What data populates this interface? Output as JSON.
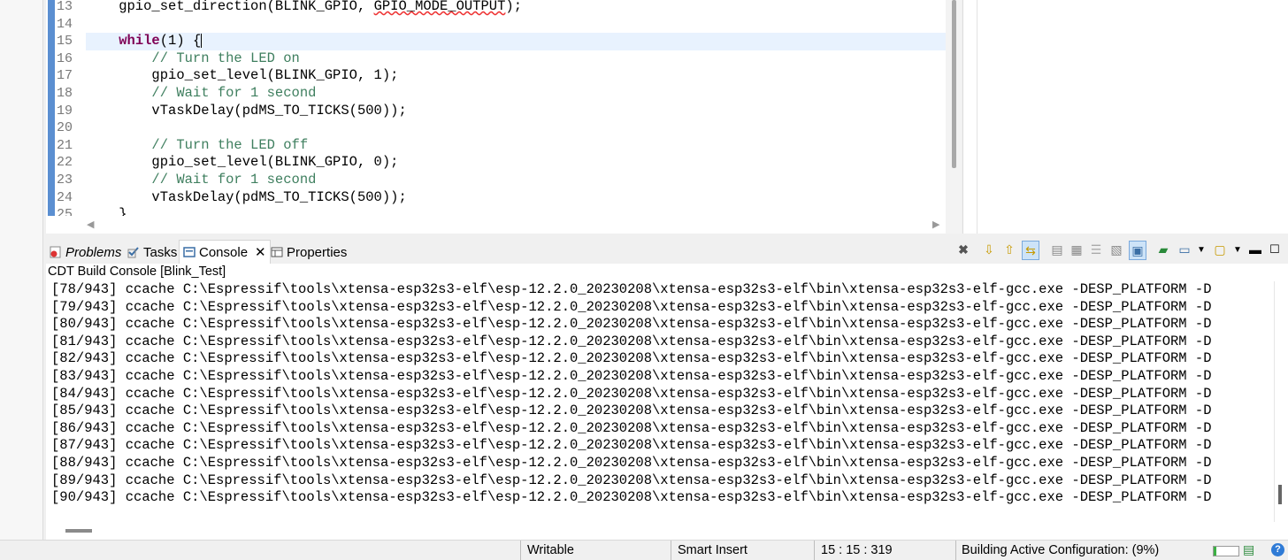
{
  "editor": {
    "lines": [
      {
        "num": "13",
        "parts": [
          {
            "t": "    gpio_set_direction(BLINK_GPIO, "
          },
          {
            "t": "GPIO_MODE_OUTPUT",
            "c": "squig"
          },
          {
            "t": ");"
          }
        ]
      },
      {
        "num": "14",
        "parts": []
      },
      {
        "num": "15",
        "current": true,
        "parts": [
          {
            "t": "    "
          },
          {
            "t": "while",
            "c": "kw"
          },
          {
            "t": "(1) {"
          }
        ]
      },
      {
        "num": "16",
        "parts": [
          {
            "t": "        // Turn the LED on",
            "c": "cm"
          }
        ]
      },
      {
        "num": "17",
        "parts": [
          {
            "t": "        gpio_set_level(BLINK_GPIO, 1);"
          }
        ]
      },
      {
        "num": "18",
        "parts": [
          {
            "t": "        // Wait for 1 second",
            "c": "cm"
          }
        ]
      },
      {
        "num": "19",
        "parts": [
          {
            "t": "        vTaskDelay(pdMS_TO_TICKS(500));"
          }
        ]
      },
      {
        "num": "20",
        "parts": []
      },
      {
        "num": "21",
        "parts": [
          {
            "t": "        // Turn the LED off",
            "c": "cm"
          }
        ]
      },
      {
        "num": "22",
        "parts": [
          {
            "t": "        gpio_set_level(BLINK_GPIO, 0);"
          }
        ]
      },
      {
        "num": "23",
        "parts": [
          {
            "t": "        // Wait for 1 second",
            "c": "cm"
          }
        ]
      },
      {
        "num": "24",
        "parts": [
          {
            "t": "        vTaskDelay(pdMS_TO_TICKS(500));"
          }
        ]
      },
      {
        "num": "25",
        "parts": [
          {
            "t": "    }"
          }
        ]
      }
    ]
  },
  "views": {
    "tabs": {
      "problems": "Problems",
      "tasks": "Tasks",
      "console": "Console",
      "properties": "Properties"
    },
    "console_title": "CDT Build Console [Blink_Test]",
    "console_lines": [
      "[78/943] ccache C:\\Espressif\\tools\\xtensa-esp32s3-elf\\esp-12.2.0_20230208\\xtensa-esp32s3-elf\\bin\\xtensa-esp32s3-elf-gcc.exe -DESP_PLATFORM -D",
      "[79/943] ccache C:\\Espressif\\tools\\xtensa-esp32s3-elf\\esp-12.2.0_20230208\\xtensa-esp32s3-elf\\bin\\xtensa-esp32s3-elf-gcc.exe -DESP_PLATFORM -D",
      "[80/943] ccache C:\\Espressif\\tools\\xtensa-esp32s3-elf\\esp-12.2.0_20230208\\xtensa-esp32s3-elf\\bin\\xtensa-esp32s3-elf-gcc.exe -DESP_PLATFORM -D",
      "[81/943] ccache C:\\Espressif\\tools\\xtensa-esp32s3-elf\\esp-12.2.0_20230208\\xtensa-esp32s3-elf\\bin\\xtensa-esp32s3-elf-gcc.exe -DESP_PLATFORM -D",
      "[82/943] ccache C:\\Espressif\\tools\\xtensa-esp32s3-elf\\esp-12.2.0_20230208\\xtensa-esp32s3-elf\\bin\\xtensa-esp32s3-elf-gcc.exe -DESP_PLATFORM -D",
      "[83/943] ccache C:\\Espressif\\tools\\xtensa-esp32s3-elf\\esp-12.2.0_20230208\\xtensa-esp32s3-elf\\bin\\xtensa-esp32s3-elf-gcc.exe -DESP_PLATFORM -D",
      "[84/943] ccache C:\\Espressif\\tools\\xtensa-esp32s3-elf\\esp-12.2.0_20230208\\xtensa-esp32s3-elf\\bin\\xtensa-esp32s3-elf-gcc.exe -DESP_PLATFORM -D",
      "[85/943] ccache C:\\Espressif\\tools\\xtensa-esp32s3-elf\\esp-12.2.0_20230208\\xtensa-esp32s3-elf\\bin\\xtensa-esp32s3-elf-gcc.exe -DESP_PLATFORM -D",
      "[86/943] ccache C:\\Espressif\\tools\\xtensa-esp32s3-elf\\esp-12.2.0_20230208\\xtensa-esp32s3-elf\\bin\\xtensa-esp32s3-elf-gcc.exe -DESP_PLATFORM -D",
      "[87/943] ccache C:\\Espressif\\tools\\xtensa-esp32s3-elf\\esp-12.2.0_20230208\\xtensa-esp32s3-elf\\bin\\xtensa-esp32s3-elf-gcc.exe -DESP_PLATFORM -D",
      "[88/943] ccache C:\\Espressif\\tools\\xtensa-esp32s3-elf\\esp-12.2.0_20230208\\xtensa-esp32s3-elf\\bin\\xtensa-esp32s3-elf-gcc.exe -DESP_PLATFORM -D",
      "[89/943] ccache C:\\Espressif\\tools\\xtensa-esp32s3-elf\\esp-12.2.0_20230208\\xtensa-esp32s3-elf\\bin\\xtensa-esp32s3-elf-gcc.exe -DESP_PLATFORM -D",
      "[90/943] ccache C:\\Espressif\\tools\\xtensa-esp32s3-elf\\esp-12.2.0_20230208\\xtensa-esp32s3-elf\\bin\\xtensa-esp32s3-elf-gcc.exe -DESP_PLATFORM -D"
    ],
    "toolbar_icons": [
      "terminate-icon",
      "next-annotation-icon",
      "previous-annotation-icon",
      "link-icon",
      "clear-console-icon",
      "scroll-lock-icon",
      "word-wrap-icon",
      "show-on-output-icon",
      "pin-console-icon",
      "open-console-icon",
      "display-selected-console-icon",
      "new-console-view-icon",
      "view-menu-icon",
      "minimize-icon",
      "maximize-icon"
    ]
  },
  "status": {
    "writable": "Writable",
    "insert_mode": "Smart Insert",
    "position": "15 : 15 : 319",
    "build": "Building Active Configuration: (9%)",
    "build_progress": 0.09
  },
  "colors": {
    "keyword": "#7f0055",
    "comment": "#3f7f5f",
    "current_line": "#e8f2fe",
    "gutter_marker": "#5b8fd1"
  }
}
